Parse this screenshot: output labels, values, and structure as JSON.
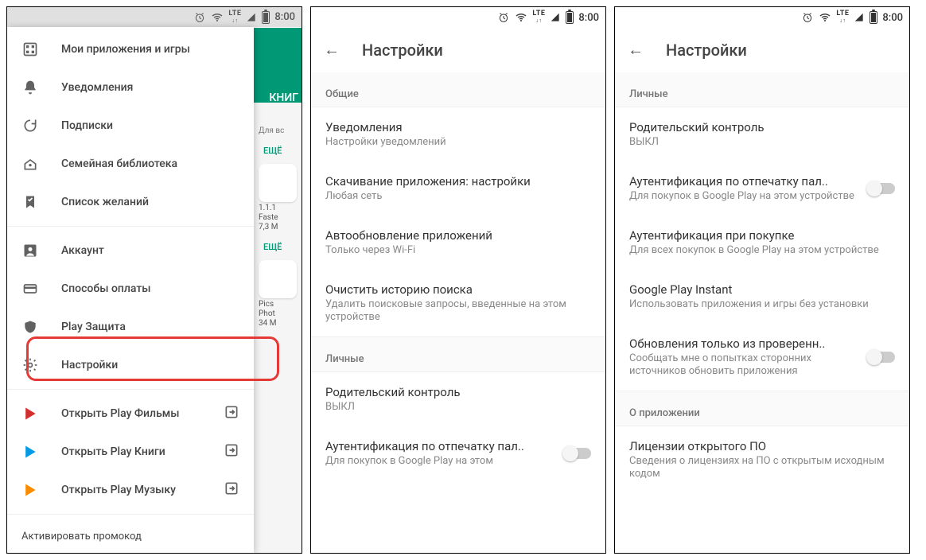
{
  "status": {
    "time": "8:00",
    "lte": "LTE"
  },
  "phone1": {
    "bg": {
      "tab": "КНИГ",
      "more": "ЕЩЁ",
      "forall": "Для вс",
      "app1a": "1.1.1",
      "app1b": "Faste",
      "app1c": "7,3 M",
      "app2a": "Pics",
      "app2b": "Phot",
      "app2c": "34 M"
    },
    "drawer": {
      "items": [
        {
          "label": "Мои приложения и игры",
          "icon": "apps"
        },
        {
          "label": "Уведомления",
          "icon": "bell"
        },
        {
          "label": "Подписки",
          "icon": "refresh"
        },
        {
          "label": "Семейная библиотека",
          "icon": "family"
        },
        {
          "label": "Список желаний",
          "icon": "bookmark"
        }
      ],
      "items2": [
        {
          "label": "Аккаунт",
          "icon": "account"
        },
        {
          "label": "Способы оплаты",
          "icon": "card"
        },
        {
          "label": "Play Защита",
          "icon": "shield"
        },
        {
          "label": "Настройки",
          "icon": "gear"
        }
      ],
      "items3": [
        {
          "label": "Открыть Play Фильмы",
          "color": "#d32f2f"
        },
        {
          "label": "Открыть Play Книги",
          "color": "#039be5"
        },
        {
          "label": "Открыть Play Музыку",
          "color": "#fb8c00"
        }
      ],
      "promo": "Активировать промокод"
    }
  },
  "phone2": {
    "title": "Настройки",
    "sec1": "Общие",
    "rows": [
      {
        "t": "Уведомления",
        "s": "Настройки уведомлений"
      },
      {
        "t": "Скачивание приложения: настройки",
        "s": "Любая сеть"
      },
      {
        "t": "Автообновление приложений",
        "s": "Только через Wi-Fi"
      },
      {
        "t": "Очистить историю поиска",
        "s": "Удалить поисковые запросы, введенные на этом устройстве"
      }
    ],
    "sec2": "Личные",
    "rows2": [
      {
        "t": "Родительский контроль",
        "s": "ВЫКЛ"
      },
      {
        "t": "Аутентификация по отпечатку пал..",
        "s": "Для покупок в Google Play на этом"
      }
    ]
  },
  "phone3": {
    "title": "Настройки",
    "sec1": "Личные",
    "rows": [
      {
        "t": "Родительский контроль",
        "s": "ВЫКЛ",
        "sw": false
      },
      {
        "t": "Аутентификация по отпечатку пал..",
        "s": "Для покупок в Google Play на этом устройстве",
        "sw": true
      },
      {
        "t": "Аутентификация при покупке",
        "s": "Для всех покупок в Google Play на этом устройстве",
        "sw": false
      },
      {
        "t": "Google Play Instant",
        "s": "Использовать приложения и игры без установки",
        "sw": false
      },
      {
        "t": "Обновления только из проверенн..",
        "s": "Сообщать мне о попытках сторонних источников обновить приложения",
        "sw": true
      }
    ],
    "sec2": "О приложении",
    "rows2": [
      {
        "t": "Лицензии открытого ПО",
        "s": "Сведения о лицензиях на ПО с открытым исходным кодом"
      }
    ]
  }
}
